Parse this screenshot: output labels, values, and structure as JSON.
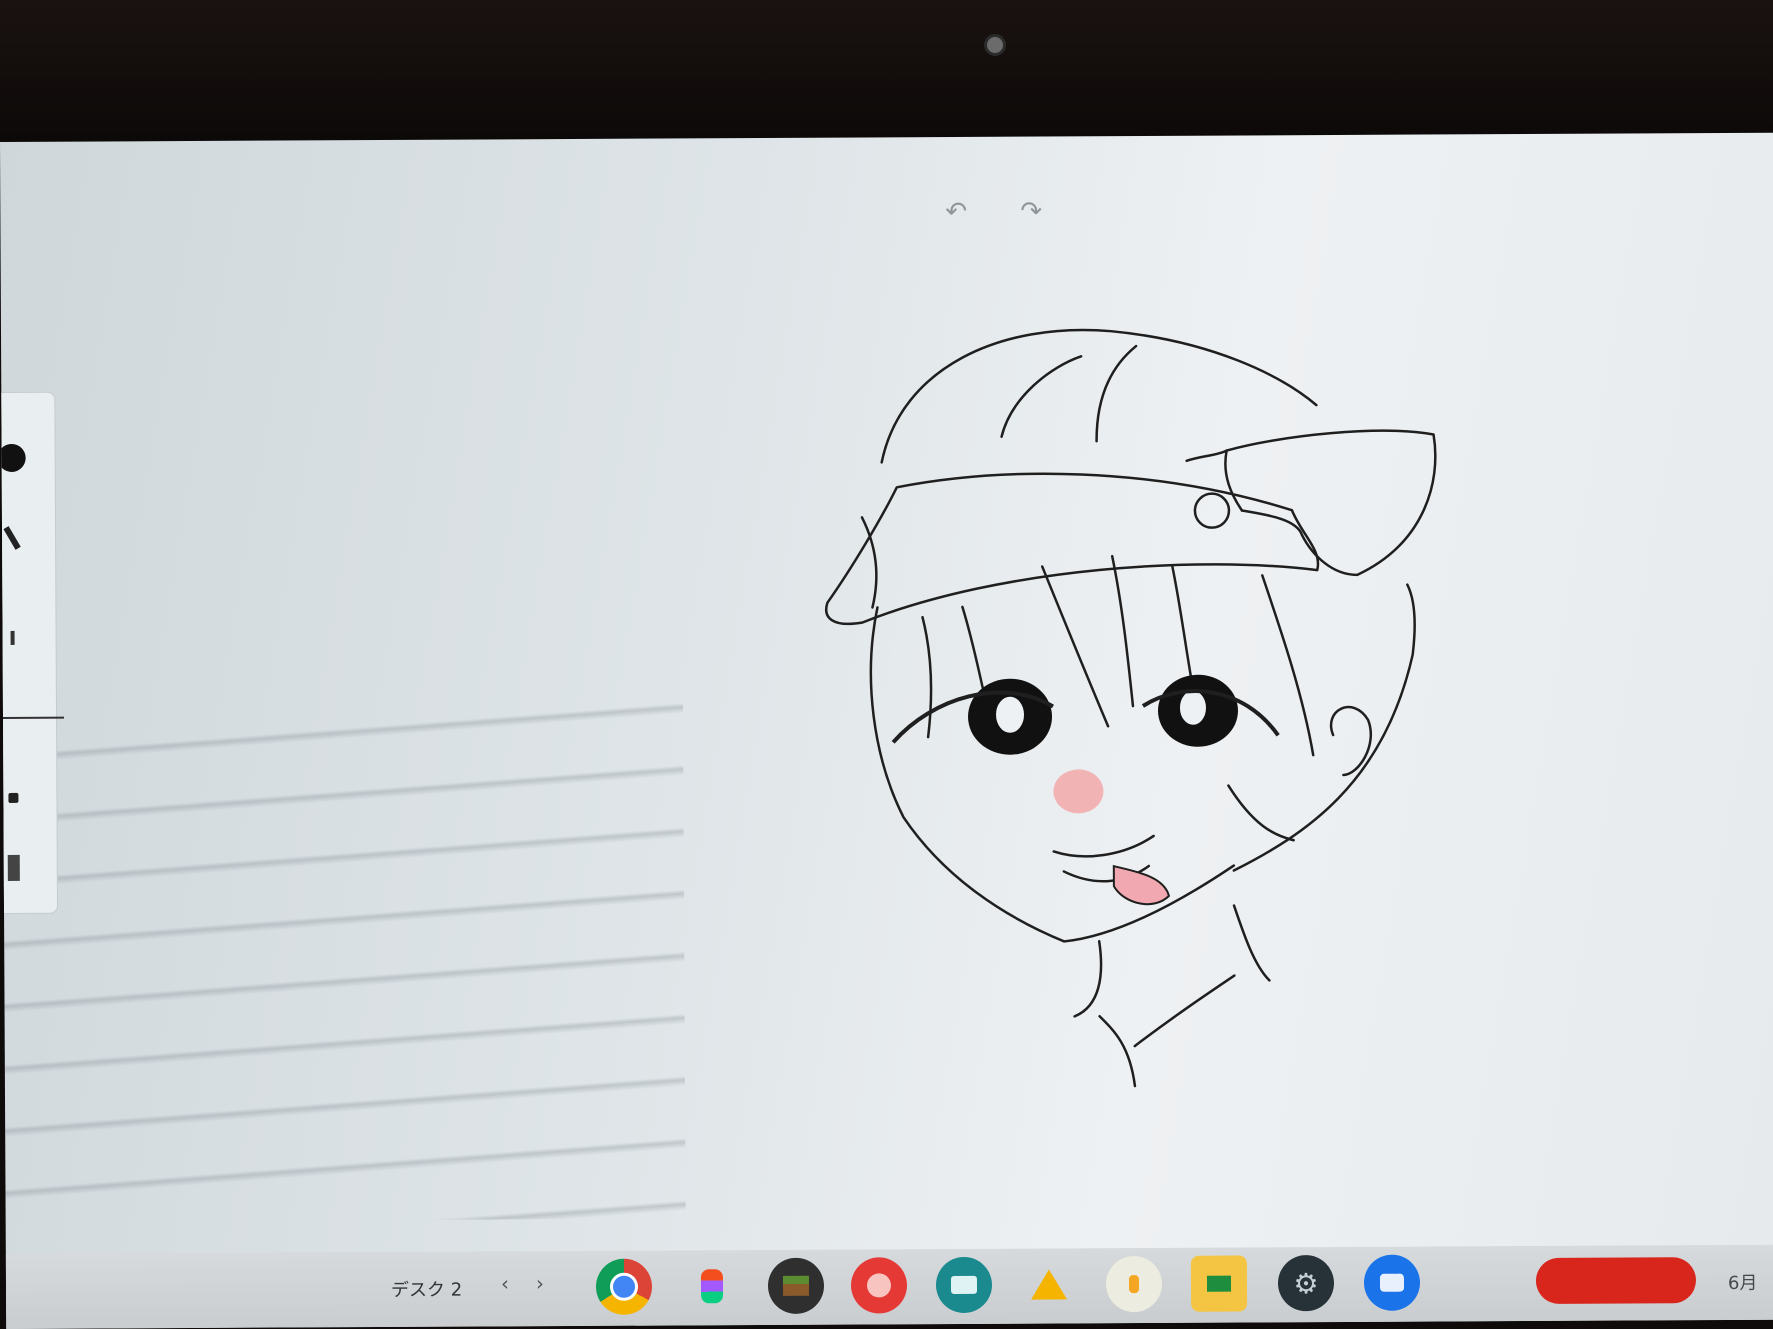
{
  "window": {
    "title": ""
  },
  "editor": {
    "undo_icon": "undo-icon",
    "redo_icon": "redo-icon"
  },
  "toolbar": {
    "tools": [
      "black-color-swatch",
      "pen-tool",
      "pencil-tool",
      "size-slider",
      "marker-tool",
      "eraser-tool"
    ]
  },
  "shelf": {
    "desk_label": "デスク 2",
    "prev_icon": "chevron-left-icon",
    "next_icon": "chevron-right-icon",
    "apps": [
      "chrome-icon",
      "figma-icon",
      "minecraft-icon",
      "art-palette-icon",
      "news-icon",
      "drive-icon",
      "music-icon",
      "classroom-icon",
      "settings-icon",
      "chat-icon"
    ],
    "date_fragment": "6月"
  },
  "colors": {
    "shelf": "#cacfd1",
    "record_button": "#d8261c",
    "drawing_ink": "#1a1a1a",
    "blush": "#f2b3b5"
  }
}
